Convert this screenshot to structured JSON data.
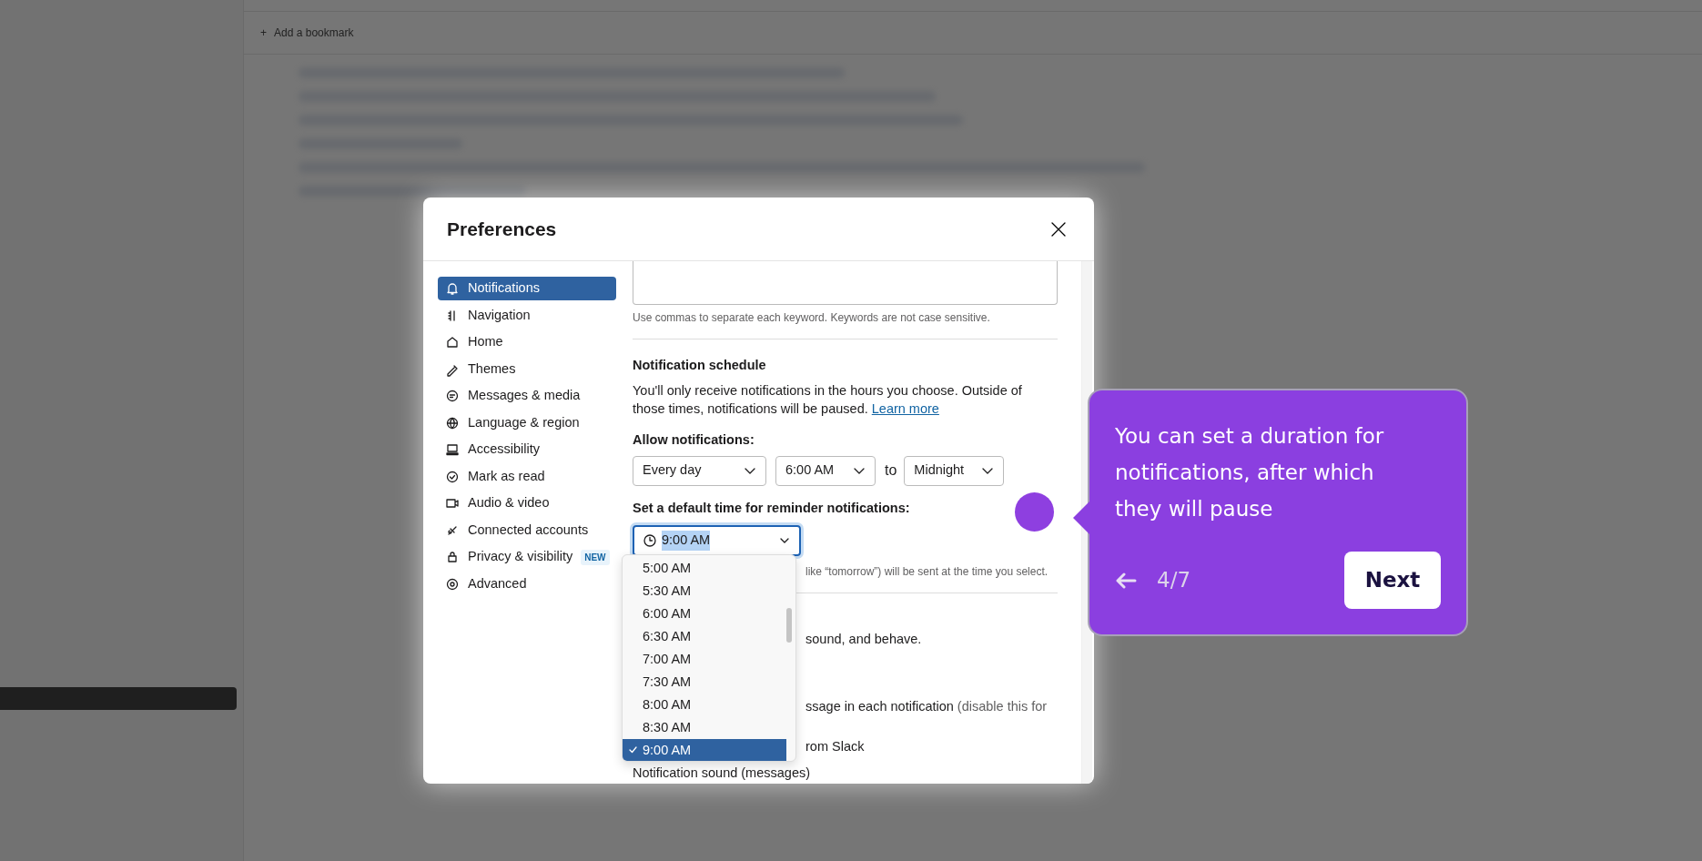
{
  "background": {
    "bookmark_bar": {
      "icon": "+",
      "label": "Add a bookmark"
    }
  },
  "dialog": {
    "title": "Preferences",
    "sidebar": {
      "items": [
        {
          "label": "Notifications",
          "selected": true
        },
        {
          "label": "Navigation",
          "selected": false
        },
        {
          "label": "Home",
          "selected": false
        },
        {
          "label": "Themes",
          "selected": false
        },
        {
          "label": "Messages & media",
          "selected": false
        },
        {
          "label": "Language & region",
          "selected": false
        },
        {
          "label": "Accessibility",
          "selected": false
        },
        {
          "label": "Mark as read",
          "selected": false
        },
        {
          "label": "Audio & video",
          "selected": false
        },
        {
          "label": "Connected accounts",
          "selected": false
        },
        {
          "label": "Privacy & visibility",
          "selected": false,
          "badge": "NEW"
        },
        {
          "label": "Advanced",
          "selected": false
        }
      ]
    },
    "content": {
      "keywords_hint": "Use commas to separate each keyword. Keywords are not case sensitive.",
      "schedule": {
        "heading": "Notification schedule",
        "text": "You'll only receive notifications in the hours you choose. Outside of those times, notifications will be paused.",
        "link": "Learn more"
      },
      "allow": {
        "label": "Allow notifications:",
        "days": "Every day",
        "from": "6:00 AM",
        "separator": "to",
        "to": "Midnight"
      },
      "reminder": {
        "label": "Set a default time for reminder notifications:",
        "value": "9:00 AM",
        "hint": "like “tomorrow”) will be sent at the time you select."
      },
      "lines": [
        {
          "text": "sound, and behave."
        },
        {
          "text": "ssage in each notification",
          "muted": "(disable this for"
        },
        {
          "text": "rom Slack"
        }
      ],
      "next_heading": "Notification sound (messages)"
    },
    "dropdown": {
      "options": [
        {
          "label": "5:00 AM",
          "selected": false
        },
        {
          "label": "5:30 AM",
          "selected": false
        },
        {
          "label": "6:00 AM",
          "selected": false
        },
        {
          "label": "6:30 AM",
          "selected": false
        },
        {
          "label": "7:00 AM",
          "selected": false
        },
        {
          "label": "7:30 AM",
          "selected": false
        },
        {
          "label": "8:00 AM",
          "selected": false
        },
        {
          "label": "8:30 AM",
          "selected": false
        },
        {
          "label": "9:00 AM",
          "selected": true
        }
      ]
    }
  },
  "tooltip": {
    "text": "You can set a duration for notifications, after which they will pause",
    "counter": "4/7",
    "next": "Next"
  }
}
